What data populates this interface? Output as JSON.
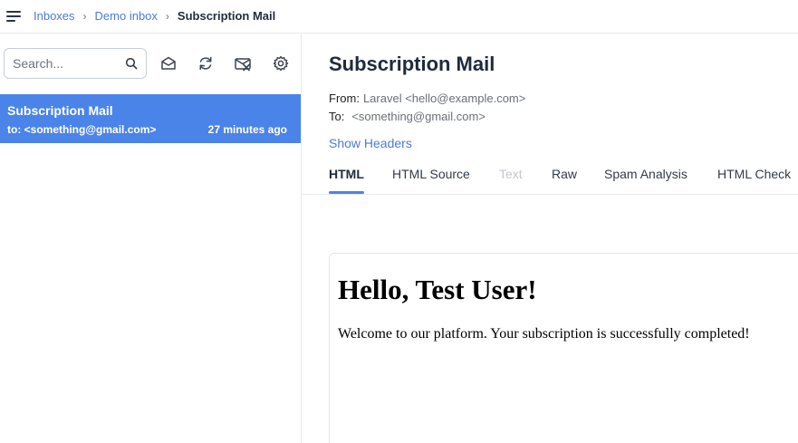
{
  "breadcrumb": {
    "items": [
      "Inboxes",
      "Demo inbox"
    ],
    "current": "Subscription Mail",
    "separator": "›"
  },
  "sidebar": {
    "search_placeholder": "Search...",
    "tools": [
      "mark-read-icon",
      "refresh-icon",
      "delete-all-icon",
      "settings-icon"
    ],
    "messages": [
      {
        "subject": "Subscription Mail",
        "to": "to: <something@gmail.com>",
        "time": "27 minutes ago",
        "selected": true
      }
    ]
  },
  "message": {
    "subject": "Subscription Mail",
    "from_label": "From:",
    "from_value": "Laravel <hello@example.com>",
    "to_label": "To:",
    "to_value": "<something@gmail.com>",
    "show_headers": "Show Headers",
    "tabs": [
      {
        "label": "HTML",
        "active": true,
        "disabled": false
      },
      {
        "label": "HTML Source",
        "active": false,
        "disabled": false
      },
      {
        "label": "Text",
        "active": false,
        "disabled": true
      },
      {
        "label": "Raw",
        "active": false,
        "disabled": false
      },
      {
        "label": "Spam Analysis",
        "active": false,
        "disabled": false
      },
      {
        "label": "HTML Check",
        "active": false,
        "disabled": false
      }
    ],
    "body": {
      "heading": "Hello, Test User!",
      "paragraph": "Welcome to our platform. Your subscription is successfully completed!"
    }
  },
  "colors": {
    "accent": "#4b84e8",
    "link": "#4b7bd9"
  }
}
